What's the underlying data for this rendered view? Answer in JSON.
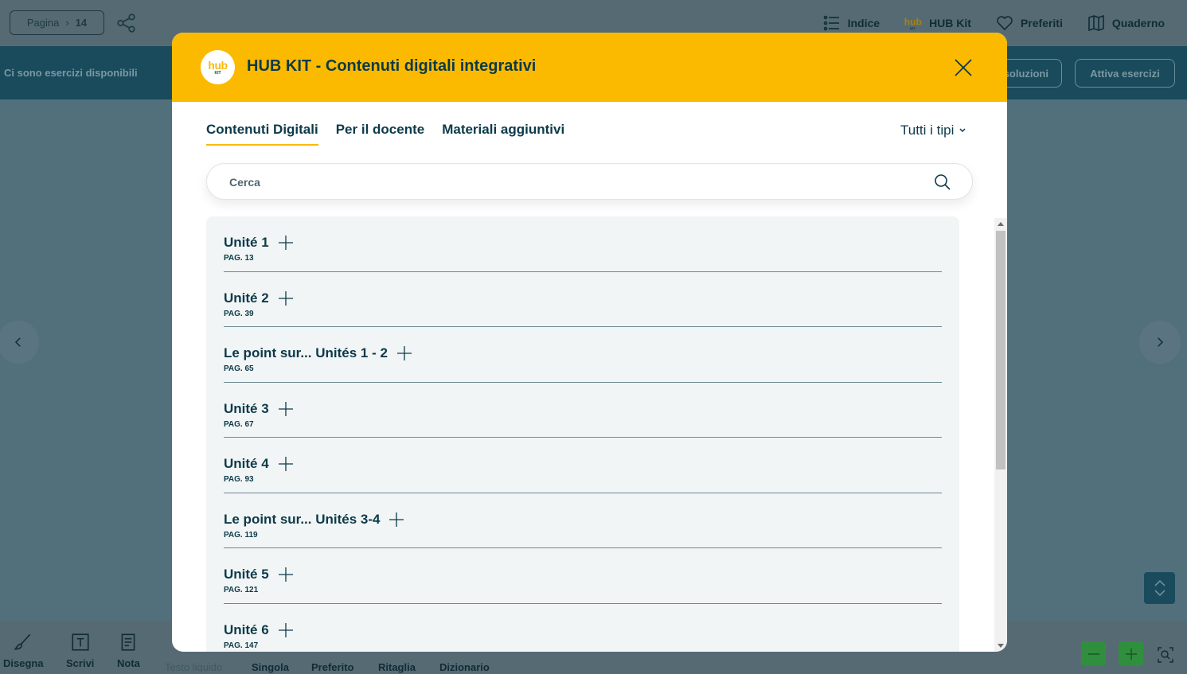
{
  "reader": {
    "page_label": "Pagina",
    "page_number": "14",
    "top_nav": [
      {
        "label": "Indice",
        "icon": "list-icon"
      },
      {
        "label": "HUB Kit",
        "icon": "hub-kit-logo"
      },
      {
        "label": "Preferiti",
        "icon": "heart-icon"
      },
      {
        "label": "Quaderno",
        "icon": "book-icon"
      }
    ],
    "exercise_message": "Ci sono esercizi disponibili",
    "solutions_button": "soluzioni",
    "activate_button": "Attiva esercizi",
    "tools": [
      {
        "label": "Disegna",
        "icon": "brush-icon"
      },
      {
        "label": "Scrivi",
        "icon": "text-box-icon"
      },
      {
        "label": "Nota",
        "icon": "note-icon"
      },
      {
        "label": "Testo liquido",
        "icon": ""
      },
      {
        "label": "Singola",
        "icon": ""
      },
      {
        "label": "Preferito",
        "icon": ""
      },
      {
        "label": "Ritaglia",
        "icon": ""
      },
      {
        "label": "Dizionario",
        "icon": ""
      }
    ]
  },
  "modal": {
    "logo_text": "hub",
    "logo_sub": "KIT",
    "title": "HUB KIT - Contenuti digitali integrativi",
    "tabs": [
      "Contenuti Digitali",
      "Per il docente",
      "Materiali aggiuntivi"
    ],
    "active_tab": "Contenuti Digitali",
    "filter_label": "Tutti i tipi",
    "search_placeholder": "Cerca",
    "units": [
      {
        "title": "Unité 1",
        "page": "PAG. 13"
      },
      {
        "title": "Unité 2",
        "page": "PAG. 39"
      },
      {
        "title": "Le point sur... Unités 1 - 2",
        "page": "PAG. 65"
      },
      {
        "title": "Unité 3",
        "page": "PAG. 67"
      },
      {
        "title": "Unité 4",
        "page": "PAG. 93"
      },
      {
        "title": "Le point sur... Unités 3-4",
        "page": "PAG. 119"
      },
      {
        "title": "Unité 5",
        "page": "PAG. 121"
      },
      {
        "title": "Unité 6",
        "page": "PAG. 147"
      }
    ]
  },
  "colors": {
    "accent": "#fbba00",
    "primary_text": "#0c3a4a",
    "overlay_bg": "#52707c"
  }
}
